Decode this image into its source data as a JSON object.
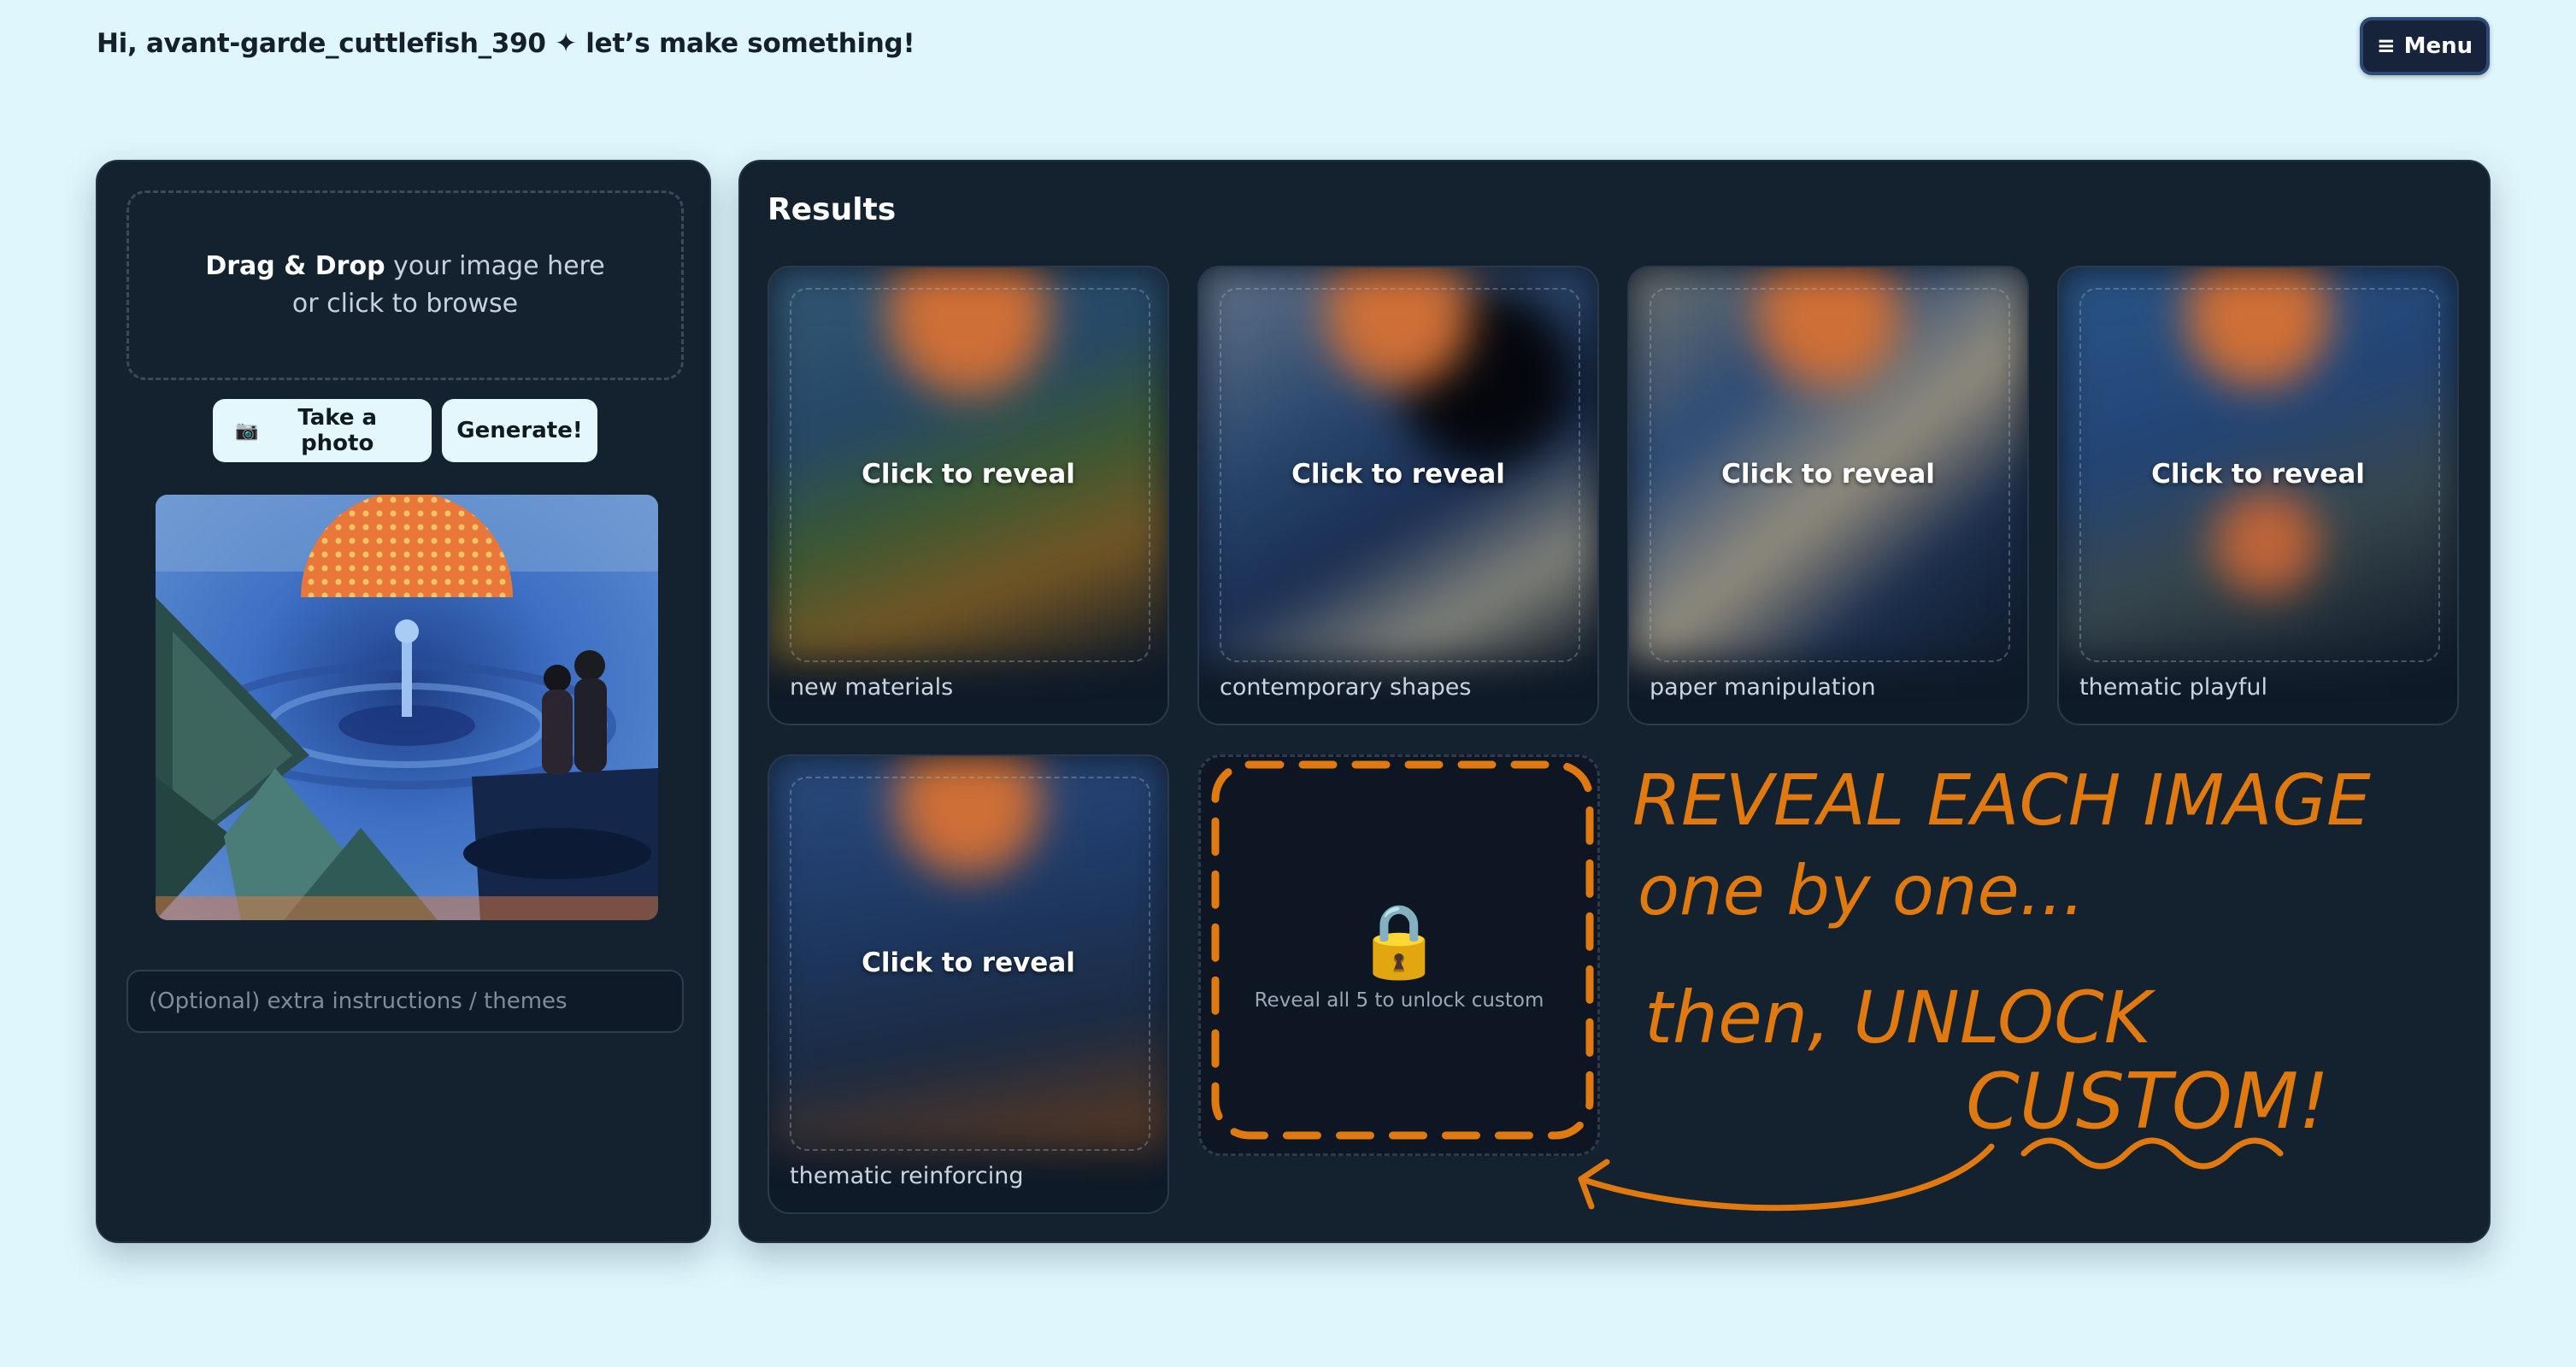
{
  "header": {
    "greeting": "Hi, avant-garde_cuttlefish_390 ✦ let’s make something!",
    "menu_icon": "≡",
    "menu_label": "Menu"
  },
  "upload": {
    "drag_bold": "Drag & Drop",
    "drag_rest": " your image here",
    "browse": "or click to browse",
    "take_photo_icon": "📷",
    "take_photo_label": "Take a photo",
    "generate_label": "Generate!",
    "extra_placeholder": "(Optional) extra instructions / themes"
  },
  "results": {
    "title": "Results",
    "reveal_text": "Click to reveal",
    "cards": [
      {
        "caption": "new materials"
      },
      {
        "caption": "contemporary shapes"
      },
      {
        "caption": "paper manipulation"
      },
      {
        "caption": "thematic playful"
      },
      {
        "caption": "thematic reinforcing"
      }
    ],
    "locked": {
      "icon": "🔒",
      "text": "Reveal all 5 to unlock custom"
    }
  },
  "annotation": {
    "line1": "REVEAL EACH IMAGE",
    "line2": "one by one...",
    "line3": "then, UNLOCK",
    "line4": "CUSTOM!",
    "color": "#e07a10"
  },
  "colors": {
    "background": "#dff6fc",
    "panel": "#14212f",
    "accent_orange": "#e07a10"
  }
}
